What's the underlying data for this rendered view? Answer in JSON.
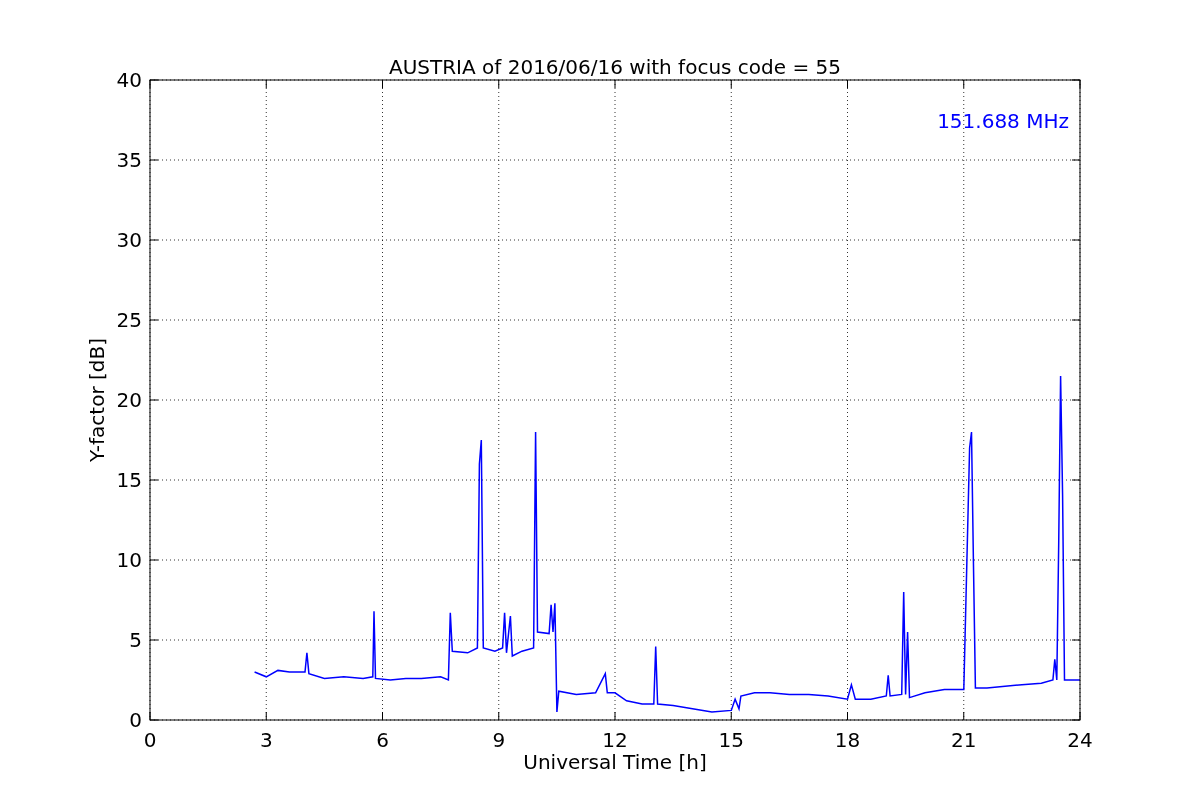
{
  "figure": {
    "chart_data": {
      "type": "line",
      "title": "AUSTRIA of 2016/06/16 with focus code = 55",
      "xlabel": "Universal Time [h]",
      "ylabel": "Y-factor [dB]",
      "grid": true,
      "xlim": [
        0,
        24
      ],
      "ylim": [
        0,
        40
      ],
      "xticks": [
        0,
        3,
        6,
        9,
        12,
        15,
        18,
        21,
        24
      ],
      "yticks": [
        0,
        5,
        10,
        15,
        20,
        25,
        30,
        35,
        40
      ],
      "x": [
        2.7,
        3.0,
        3.3,
        3.6,
        4.0,
        4.05,
        4.1,
        4.5,
        5.0,
        5.5,
        5.75,
        5.78,
        5.82,
        6.2,
        6.6,
        7.0,
        7.5,
        7.7,
        7.75,
        7.8,
        8.2,
        8.45,
        8.5,
        8.55,
        8.6,
        8.9,
        9.1,
        9.15,
        9.2,
        9.3,
        9.35,
        9.6,
        9.9,
        9.95,
        10.0,
        10.3,
        10.35,
        10.4,
        10.45,
        10.5,
        10.55,
        11.0,
        11.5,
        11.75,
        11.8,
        12.0,
        12.3,
        12.7,
        13.0,
        13.05,
        13.1,
        13.5,
        14.0,
        14.5,
        15.0,
        15.1,
        15.2,
        15.25,
        15.6,
        16.0,
        16.5,
        17.0,
        17.5,
        18.0,
        18.1,
        18.2,
        18.6,
        19.0,
        19.05,
        19.1,
        19.4,
        19.45,
        19.5,
        19.55,
        19.6,
        20.0,
        20.5,
        21.0,
        21.15,
        21.2,
        21.25,
        21.3,
        21.6,
        22.0,
        22.5,
        23.0,
        23.3,
        23.35,
        23.4,
        23.45,
        23.5,
        23.55,
        23.6,
        24.0
      ],
      "series": [
        {
          "name": "151.688 MHz",
          "color": "#0000ff",
          "values": [
            3.0,
            2.7,
            3.1,
            3.0,
            3.0,
            4.2,
            2.9,
            2.6,
            2.7,
            2.6,
            2.7,
            6.8,
            2.6,
            2.5,
            2.6,
            2.6,
            2.7,
            2.5,
            6.7,
            4.3,
            4.2,
            4.5,
            16.0,
            17.5,
            4.5,
            4.3,
            4.5,
            6.7,
            4.2,
            6.5,
            4.0,
            4.3,
            4.5,
            18.0,
            5.5,
            5.4,
            7.2,
            5.5,
            7.3,
            0.5,
            1.8,
            1.6,
            1.7,
            2.9,
            1.7,
            1.7,
            1.2,
            1.0,
            1.0,
            4.6,
            1.0,
            0.9,
            0.7,
            0.5,
            0.6,
            1.3,
            0.7,
            1.5,
            1.7,
            1.7,
            1.6,
            1.6,
            1.5,
            1.3,
            2.2,
            1.3,
            1.3,
            1.5,
            2.8,
            1.5,
            1.6,
            8.0,
            1.6,
            5.5,
            1.4,
            1.7,
            1.9,
            1.9,
            17.0,
            18.0,
            10.0,
            2.0,
            2.0,
            2.1,
            2.2,
            2.3,
            2.5,
            3.8,
            2.5,
            11.0,
            21.5,
            14.0,
            2.5,
            2.5
          ]
        }
      ]
    }
  }
}
